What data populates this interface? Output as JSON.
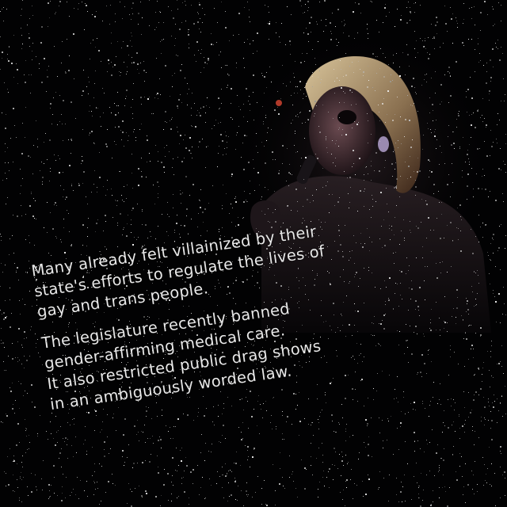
{
  "caption": {
    "paragraph_1": "Many already felt villainized by their\nstate's efforts to regulate the lives of\ngay and trans people.",
    "paragraph_2": "The legislature recently banned\ngender-affirming medical care.\nIt also restricted public drag shows\nin an ambiguously worded law."
  },
  "colors": {
    "background": "#020203",
    "text": "#e8e8e8",
    "hair": "#c8b48a",
    "skin": "#5a3a40",
    "accent_red": "#b03a2a"
  }
}
